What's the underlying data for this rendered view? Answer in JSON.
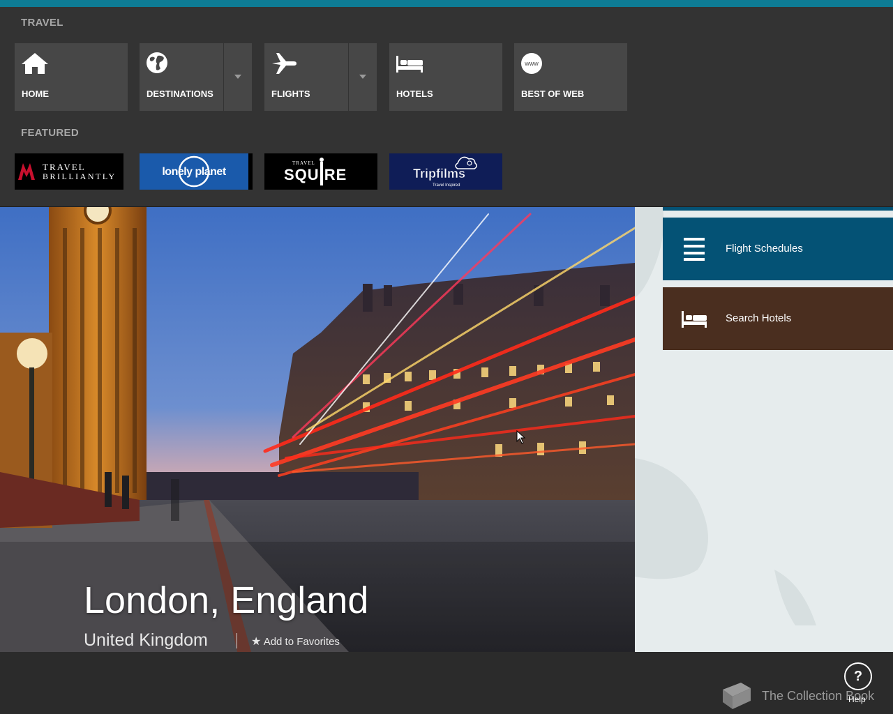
{
  "colors": {
    "accent": "#0e7c95",
    "nav_bg": "#333333",
    "tile_bg": "#474747",
    "flight_tile": "#045275",
    "hotel_tile": "#4a2e1f"
  },
  "nav": {
    "section_label": "TRAVEL",
    "tiles": [
      {
        "label": "HOME",
        "icon": "home-icon"
      },
      {
        "label": "DESTINATIONS",
        "icon": "globe-icon",
        "has_dropdown": true
      },
      {
        "label": "FLIGHTS",
        "icon": "airplane-icon",
        "has_dropdown": true
      },
      {
        "label": "HOTELS",
        "icon": "bed-icon"
      },
      {
        "label": "BEST OF WEB",
        "icon": "www-icon",
        "icon_text": "www"
      }
    ]
  },
  "featured": {
    "section_label": "FEATURED",
    "partners": [
      {
        "name": "travel-brilliantly",
        "line1": "TRAVEL",
        "line2": "BRILLIANTLY",
        "bg": "#000000"
      },
      {
        "name": "lonely-planet",
        "text": "lonely planet",
        "bg": "#1a5aab"
      },
      {
        "name": "travel-squire",
        "small": "TRAVEL",
        "text": "SQUIRE",
        "bg": "#000000"
      },
      {
        "name": "tripfilms",
        "text": "Tripfilms",
        "tagline": "Travel Inspired",
        "bg": "#0f1d57"
      }
    ]
  },
  "hero": {
    "title": "London, England",
    "subtitle": "United Kingdom",
    "favorite_label": "Add to Favorites"
  },
  "side_actions": [
    {
      "label": "Flight Schedules",
      "icon": "list-icon",
      "color": "#045275"
    },
    {
      "label": "Search Hotels",
      "icon": "bed-icon",
      "color": "#4a2e1f"
    }
  ],
  "footer": {
    "help_glyph": "?",
    "help_label": "Help",
    "collection_label": "The Collection Book"
  }
}
